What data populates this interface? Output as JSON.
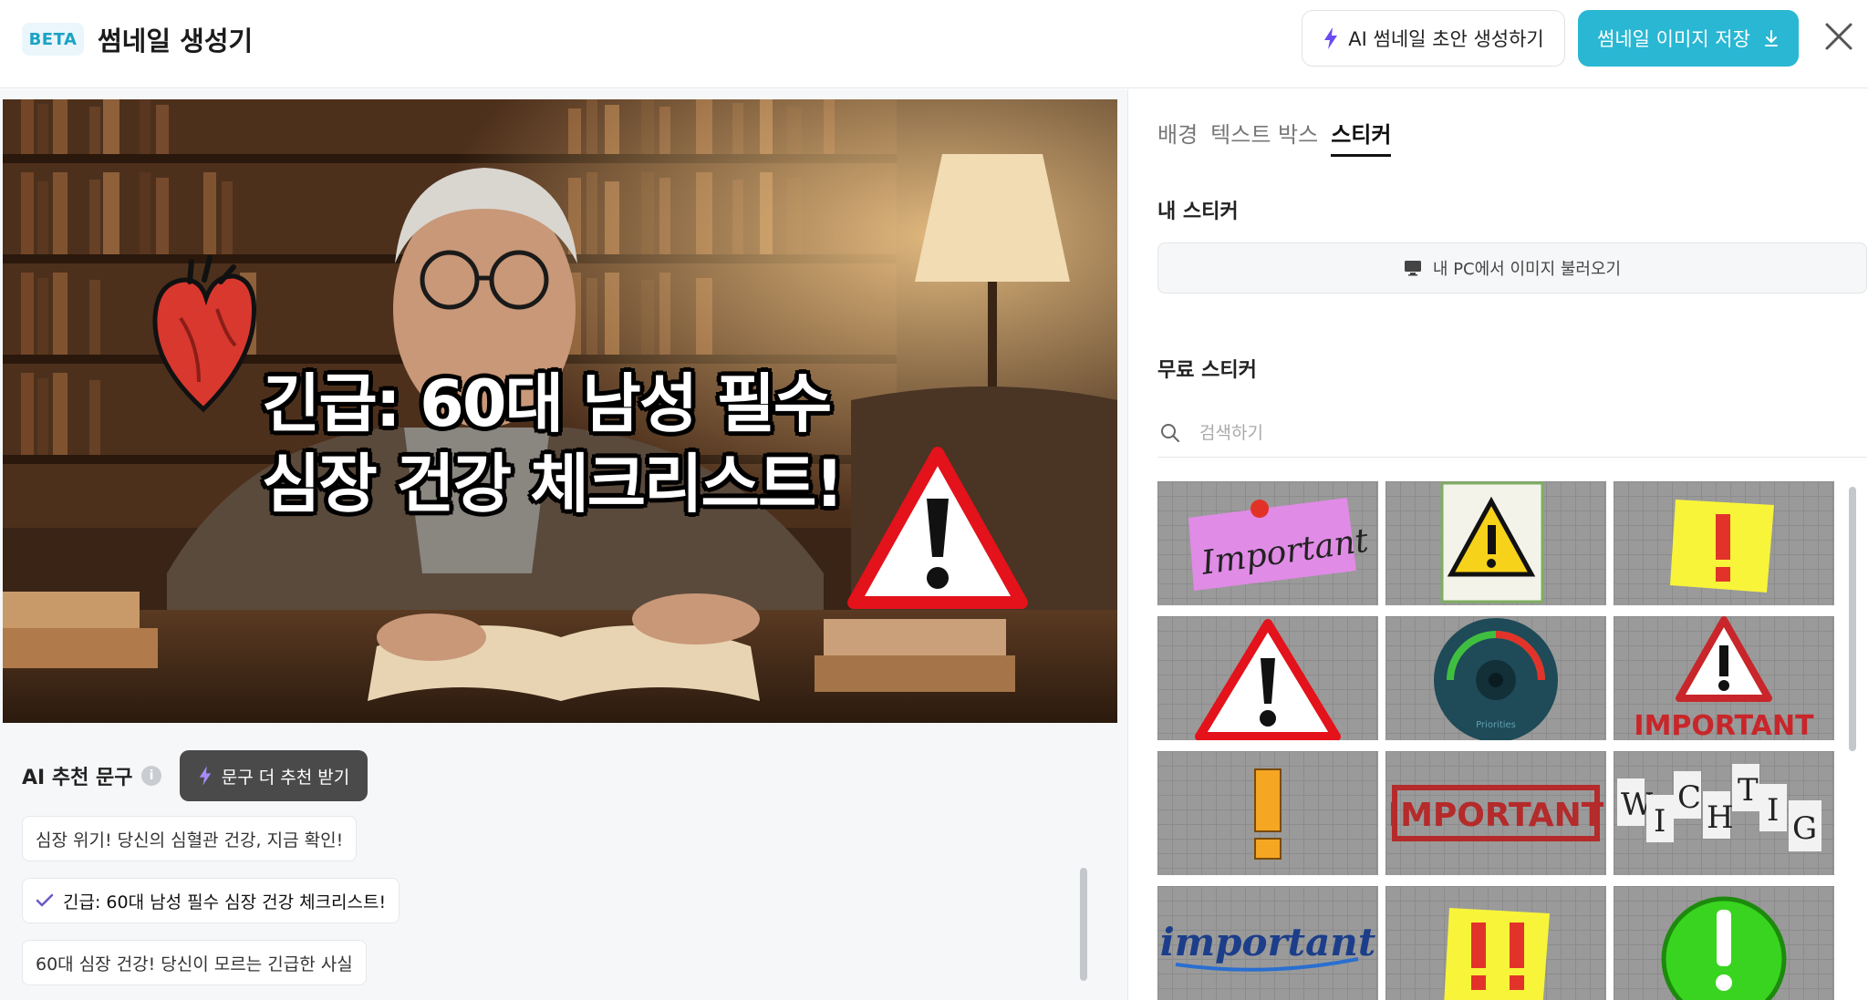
{
  "header": {
    "beta_badge": "BETA",
    "title": "썸네일 생성기",
    "ai_draft_button": "AI 썸네일 초안 생성하기",
    "save_button": "썸네일 이미지 저장"
  },
  "canvas": {
    "headline_line1": "긴급: 60대 남성 필수",
    "headline_line2": "심장 건강 체크리스트!"
  },
  "ai_suggestions": {
    "title": "AI 추천 문구",
    "more_button": "문구 더 추천 받기",
    "items": [
      {
        "text": "심장 위기! 당신의 심혈관 건강, 지금 확인!",
        "selected": false
      },
      {
        "text": "긴급: 60대 남성 필수 심장 건강 체크리스트!",
        "selected": true
      },
      {
        "text": "60대 심장 건강! 당신이 모르는 긴급한 사실",
        "selected": false
      }
    ]
  },
  "right_panel": {
    "tabs": [
      {
        "label": "배경",
        "active": false
      },
      {
        "label": "텍스트 박스",
        "active": false
      },
      {
        "label": "스티커",
        "active": true
      }
    ],
    "my_stickers_label": "내 스티커",
    "upload_button": "내 PC에서 이미지 불러오기",
    "free_stickers_label": "무료 스티커",
    "search_placeholder": "검색하기",
    "sticker_texts": {
      "important_note": "Important",
      "important_red": "IMPORTANT",
      "important_stamp": "IMPORTANT",
      "wichtig": [
        "W",
        "I",
        "C",
        "H",
        "T",
        "I",
        "G"
      ],
      "important_script": "important",
      "gauge": "Priorities"
    },
    "stickers": [
      {
        "name": "sticker-important-note"
      },
      {
        "name": "sticker-warning-yellow"
      },
      {
        "name": "sticker-exclamation-note"
      },
      {
        "name": "sticker-warning-red-triangle"
      },
      {
        "name": "sticker-gauge"
      },
      {
        "name": "sticker-important-warning"
      },
      {
        "name": "sticker-exclamation-orange"
      },
      {
        "name": "sticker-important-stamp"
      },
      {
        "name": "sticker-wichtig"
      },
      {
        "name": "sticker-important-script"
      },
      {
        "name": "sticker-exclamation-double"
      },
      {
        "name": "sticker-exclamation-green"
      }
    ]
  },
  "colors": {
    "accent": "#29b7d3",
    "beta_bg": "#eaf6fb",
    "more_button_bg": "#4a4a4a",
    "lightning": "#6c4cf1"
  }
}
